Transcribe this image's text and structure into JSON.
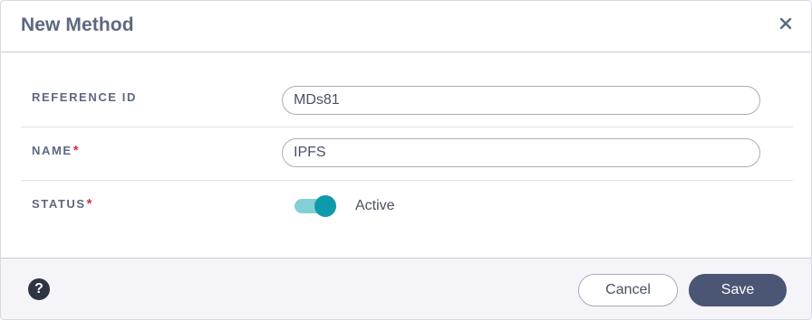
{
  "dialog": {
    "title": "New Method"
  },
  "form": {
    "reference_id": {
      "label": "REFERENCE ID",
      "value": "MDs81"
    },
    "name": {
      "label": "NAME",
      "required_mark": "*",
      "value": "IPFS"
    },
    "status": {
      "label": "STATUS",
      "required_mark": "*",
      "toggle_on": true,
      "value_text": "Active"
    }
  },
  "footer": {
    "help_glyph": "?",
    "cancel_label": "Cancel",
    "save_label": "Save"
  },
  "icons": {
    "close": "close-icon",
    "help": "help-icon"
  },
  "colors": {
    "title": "#5d6880",
    "required": "#d0343d",
    "toggle_track": "#83cfd6",
    "toggle_knob": "#0f9aab",
    "save_button": "#4a5673",
    "footer_bg": "#f4f4f9"
  }
}
